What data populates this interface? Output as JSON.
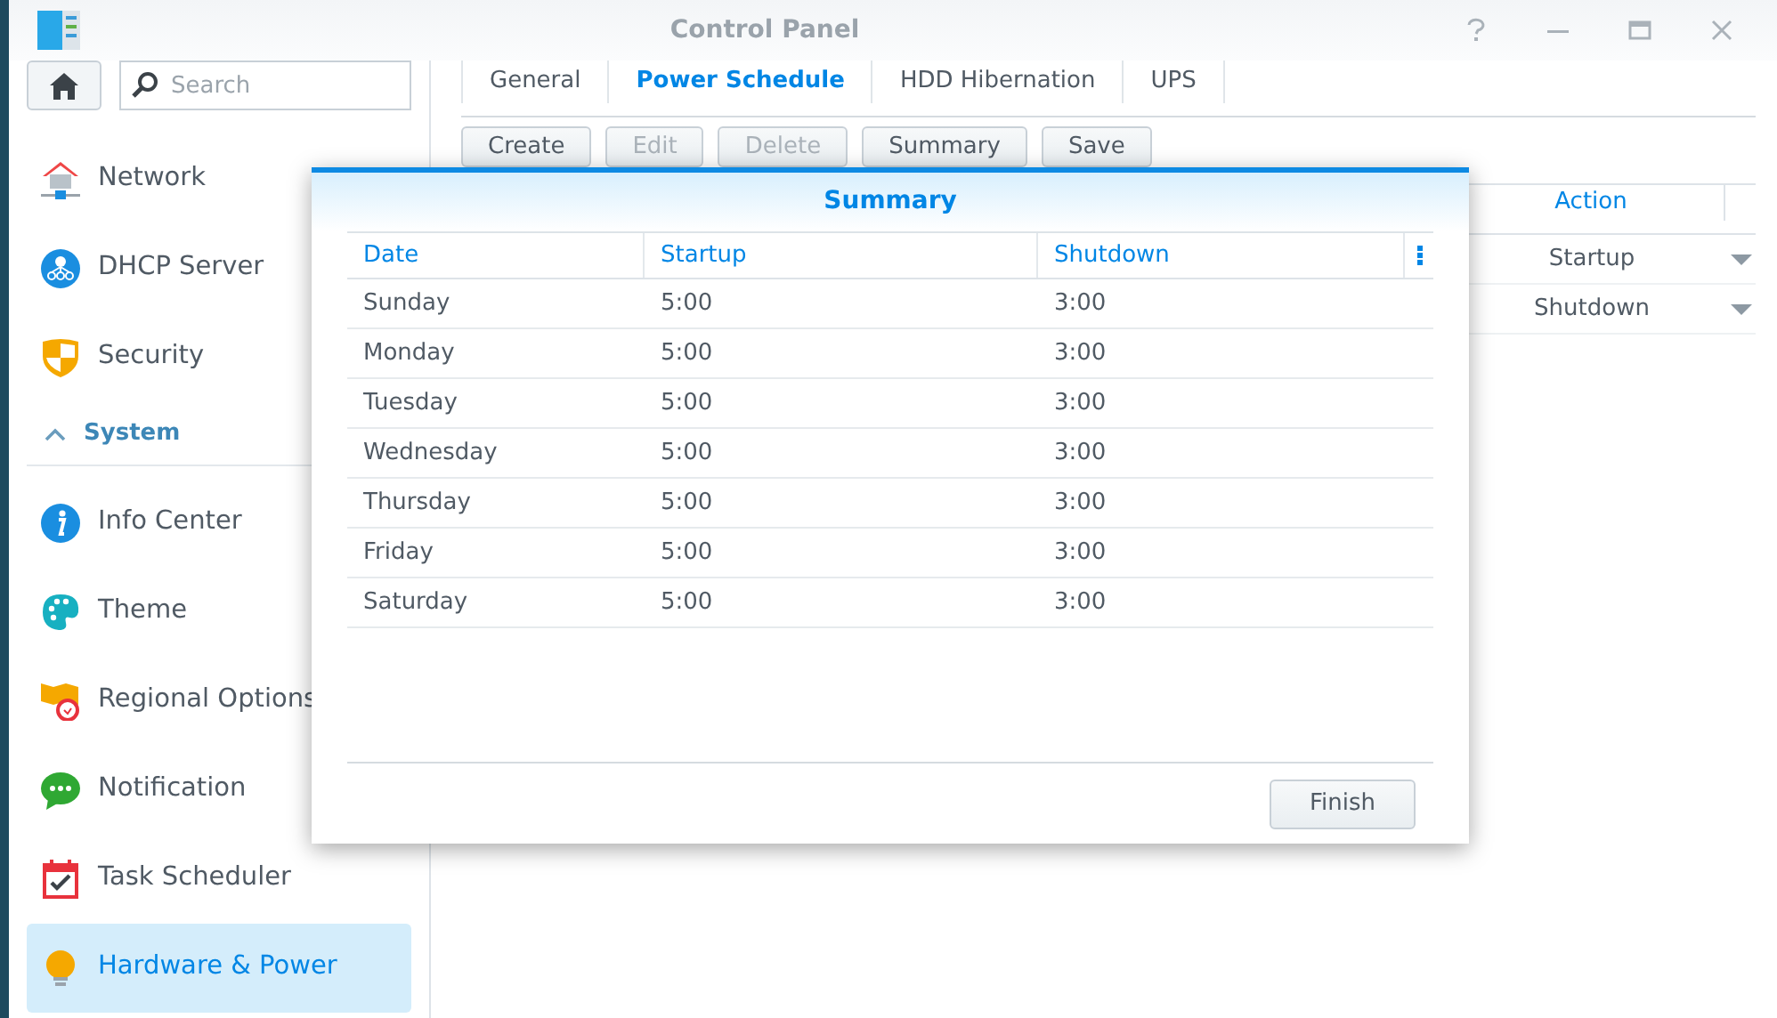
{
  "window": {
    "title": "Control Panel"
  },
  "toolbar": {
    "search": {
      "placeholder": "Search"
    }
  },
  "sidebar": {
    "items": [
      {
        "kind": "item",
        "label": "Network",
        "selected": false
      },
      {
        "kind": "item",
        "label": "DHCP Server",
        "selected": false
      },
      {
        "kind": "item",
        "label": "Security",
        "selected": false
      },
      {
        "kind": "section",
        "label": "System",
        "expanded": true
      },
      {
        "kind": "item",
        "label": "Info Center",
        "selected": false
      },
      {
        "kind": "item",
        "label": "Theme",
        "selected": false
      },
      {
        "kind": "item",
        "label": "Regional Options",
        "selected": false
      },
      {
        "kind": "item",
        "label": "Notification",
        "selected": false
      },
      {
        "kind": "item",
        "label": "Task Scheduler",
        "selected": false
      },
      {
        "kind": "item",
        "label": "Hardware & Power",
        "selected": true
      }
    ]
  },
  "tabs": [
    {
      "label": "General",
      "selected": false
    },
    {
      "label": "Power Schedule",
      "selected": true
    },
    {
      "label": "HDD Hibernation",
      "selected": false
    },
    {
      "label": "UPS",
      "selected": false
    }
  ],
  "actions": [
    {
      "label": "Create",
      "disabled": false
    },
    {
      "label": "Edit",
      "disabled": true
    },
    {
      "label": "Delete",
      "disabled": true
    },
    {
      "label": "Summary",
      "disabled": false
    },
    {
      "label": "Save",
      "disabled": false
    }
  ],
  "schedule_table": {
    "columns": [
      "Action"
    ],
    "rows": [
      {
        "action": "Startup"
      },
      {
        "action": "Shutdown"
      }
    ]
  },
  "dialog": {
    "title": "Summary",
    "columns": [
      "Date",
      "Startup",
      "Shutdown"
    ],
    "rows": [
      {
        "date": "Sunday",
        "startup": "5:00",
        "shutdown": "3:00"
      },
      {
        "date": "Monday",
        "startup": "5:00",
        "shutdown": "3:00"
      },
      {
        "date": "Tuesday",
        "startup": "5:00",
        "shutdown": "3:00"
      },
      {
        "date": "Wednesday",
        "startup": "5:00",
        "shutdown": "3:00"
      },
      {
        "date": "Thursday",
        "startup": "5:00",
        "shutdown": "3:00"
      },
      {
        "date": "Friday",
        "startup": "5:00",
        "shutdown": "3:00"
      },
      {
        "date": "Saturday",
        "startup": "5:00",
        "shutdown": "3:00"
      }
    ],
    "button": "Finish"
  }
}
